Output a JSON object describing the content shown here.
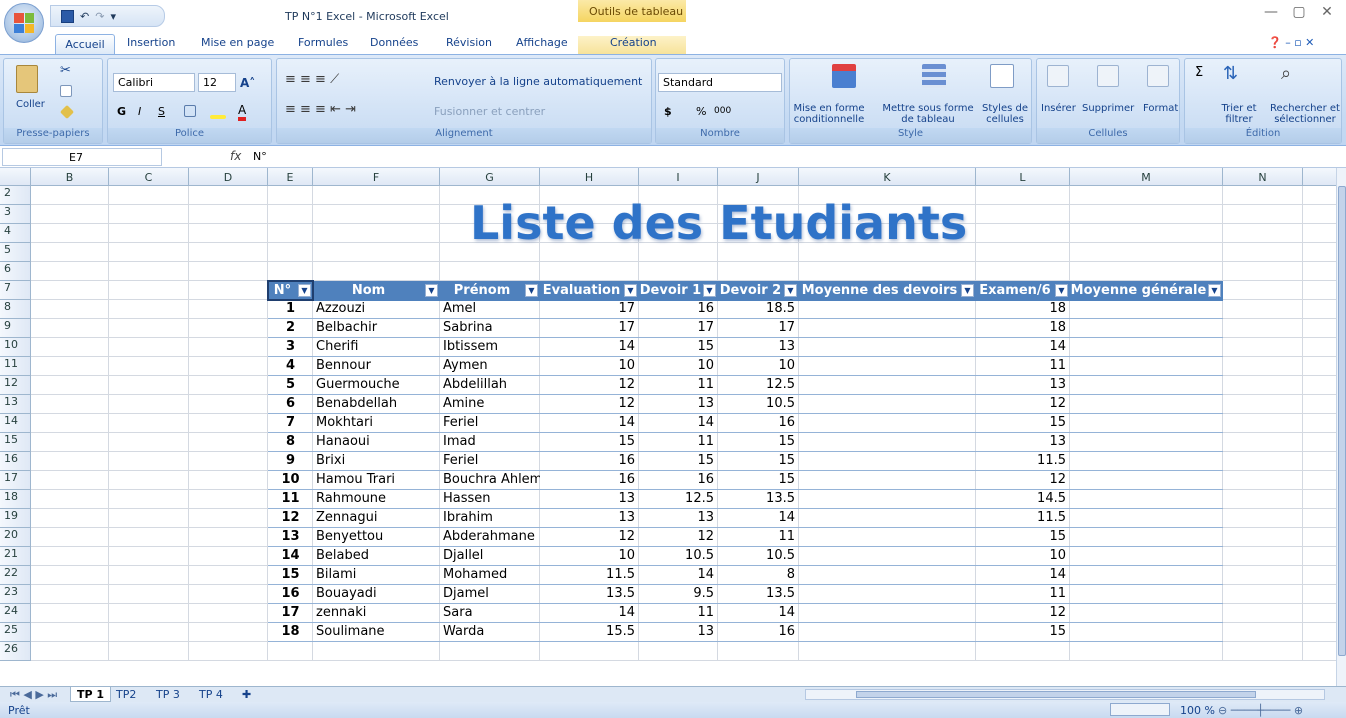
{
  "window": {
    "title": "TP N°1 Excel - Microsoft Excel",
    "context_title": "Outils de tableau",
    "controls": [
      "—",
      "▢",
      "✕"
    ]
  },
  "ribbon_tabs": [
    "Accueil",
    "Insertion",
    "Mise en page",
    "Formules",
    "Données",
    "Révision",
    "Affichage",
    "Création"
  ],
  "ribbon": {
    "clipboard": {
      "paste_label": "Coller",
      "group_label": "Presse-papiers"
    },
    "font": {
      "font_name": "Calibri",
      "font_size": "12",
      "group_label": "Police",
      "bold": "G",
      "italic": "I",
      "underline": "S"
    },
    "alignment": {
      "wrap": "Renvoyer à la ligne automatiquement",
      "merge": "Fusionner et centrer",
      "group_label": "Alignement"
    },
    "number": {
      "format": "Standard",
      "currency": "$",
      "percent": "%",
      "thousands": "000",
      "group_label": "Nombre"
    },
    "style": {
      "cond_format": "Mise en forme conditionnelle",
      "table_format": "Mettre sous forme de tableau",
      "cell_styles": "Styles de cellules",
      "group_label": "Style"
    },
    "cells": {
      "insert": "Insérer",
      "delete": "Supprimer",
      "format": "Format",
      "group_label": "Cellules"
    },
    "editing": {
      "sort": "Trier et filtrer",
      "find": "Rechercher et sélectionner",
      "group_label": "Édition",
      "sigma": "Σ"
    }
  },
  "formula_bar": {
    "cell_ref": "E7",
    "fx": "fx",
    "content": "N°"
  },
  "columns": [
    "B",
    "C",
    "D",
    "E",
    "F",
    "G",
    "H",
    "I",
    "J",
    "K",
    "L",
    "M",
    "N"
  ],
  "rows": [
    "2",
    "3",
    "4",
    "5",
    "6",
    "7",
    "8",
    "9",
    "10",
    "11",
    "12",
    "13",
    "14",
    "15",
    "16",
    "17",
    "18",
    "19",
    "20",
    "21",
    "22",
    "23",
    "24",
    "25",
    "26"
  ],
  "sheet_title": "Liste des Etudiants",
  "table": {
    "headers": [
      "N°",
      "Nom",
      "Prénom",
      "Evaluation",
      "Devoir 1",
      "Devoir 2",
      "Moyenne des devoirs",
      "Examen/6",
      "Moyenne générale"
    ],
    "rows": [
      [
        "1",
        "Azzouzi",
        "Amel",
        "17",
        "16",
        "18.5",
        "",
        "18",
        ""
      ],
      [
        "2",
        "Belbachir",
        "Sabrina",
        "17",
        "17",
        "17",
        "",
        "18",
        ""
      ],
      [
        "3",
        "Cherifi",
        "Ibtissem",
        "14",
        "15",
        "13",
        "",
        "14",
        ""
      ],
      [
        "4",
        "Bennour",
        "Aymen",
        "10",
        "10",
        "10",
        "",
        "11",
        ""
      ],
      [
        "5",
        "Guermouche",
        "Abdelillah",
        "12",
        "11",
        "12.5",
        "",
        "13",
        ""
      ],
      [
        "6",
        "Benabdellah",
        "Amine",
        "12",
        "13",
        "10.5",
        "",
        "12",
        ""
      ],
      [
        "7",
        "Mokhtari",
        "Feriel",
        "14",
        "14",
        "16",
        "",
        "15",
        ""
      ],
      [
        "8",
        "Hanaoui",
        "Imad",
        "15",
        "11",
        "15",
        "",
        "13",
        ""
      ],
      [
        "9",
        "Brixi",
        "Feriel",
        "16",
        "15",
        "15",
        "",
        "11.5",
        ""
      ],
      [
        "10",
        "Hamou Trari",
        "Bouchra Ahlem",
        "16",
        "16",
        "15",
        "",
        "12",
        ""
      ],
      [
        "11",
        "Rahmoune",
        "Hassen",
        "13",
        "12.5",
        "13.5",
        "",
        "14.5",
        ""
      ],
      [
        "12",
        "Zennagui",
        "Ibrahim",
        "13",
        "13",
        "14",
        "",
        "11.5",
        ""
      ],
      [
        "13",
        "Benyettou",
        "Abderahmane",
        "12",
        "12",
        "11",
        "",
        "15",
        ""
      ],
      [
        "14",
        "Belabed",
        "Djallel",
        "10",
        "10.5",
        "10.5",
        "",
        "10",
        ""
      ],
      [
        "15",
        "Bilami",
        "Mohamed",
        "11.5",
        "14",
        "8",
        "",
        "14",
        ""
      ],
      [
        "16",
        "Bouayadi",
        "Djamel",
        "13.5",
        "9.5",
        "13.5",
        "",
        "11",
        ""
      ],
      [
        "17",
        "zennaki",
        "Sara",
        "14",
        "11",
        "14",
        "",
        "12",
        ""
      ],
      [
        "18",
        "Soulimane",
        "Warda",
        "15.5",
        "13",
        "16",
        "",
        "15",
        ""
      ]
    ]
  },
  "sheet_tabs": [
    "TP 1",
    "TP2",
    "TP 3",
    "TP 4"
  ],
  "status": {
    "ready": "Prêt",
    "zoom": "100 %"
  },
  "colors": {
    "header_blue": "#4f81bd",
    "title_blue": "#2f73c8",
    "ribbon_bg": "#d3e3f6"
  }
}
